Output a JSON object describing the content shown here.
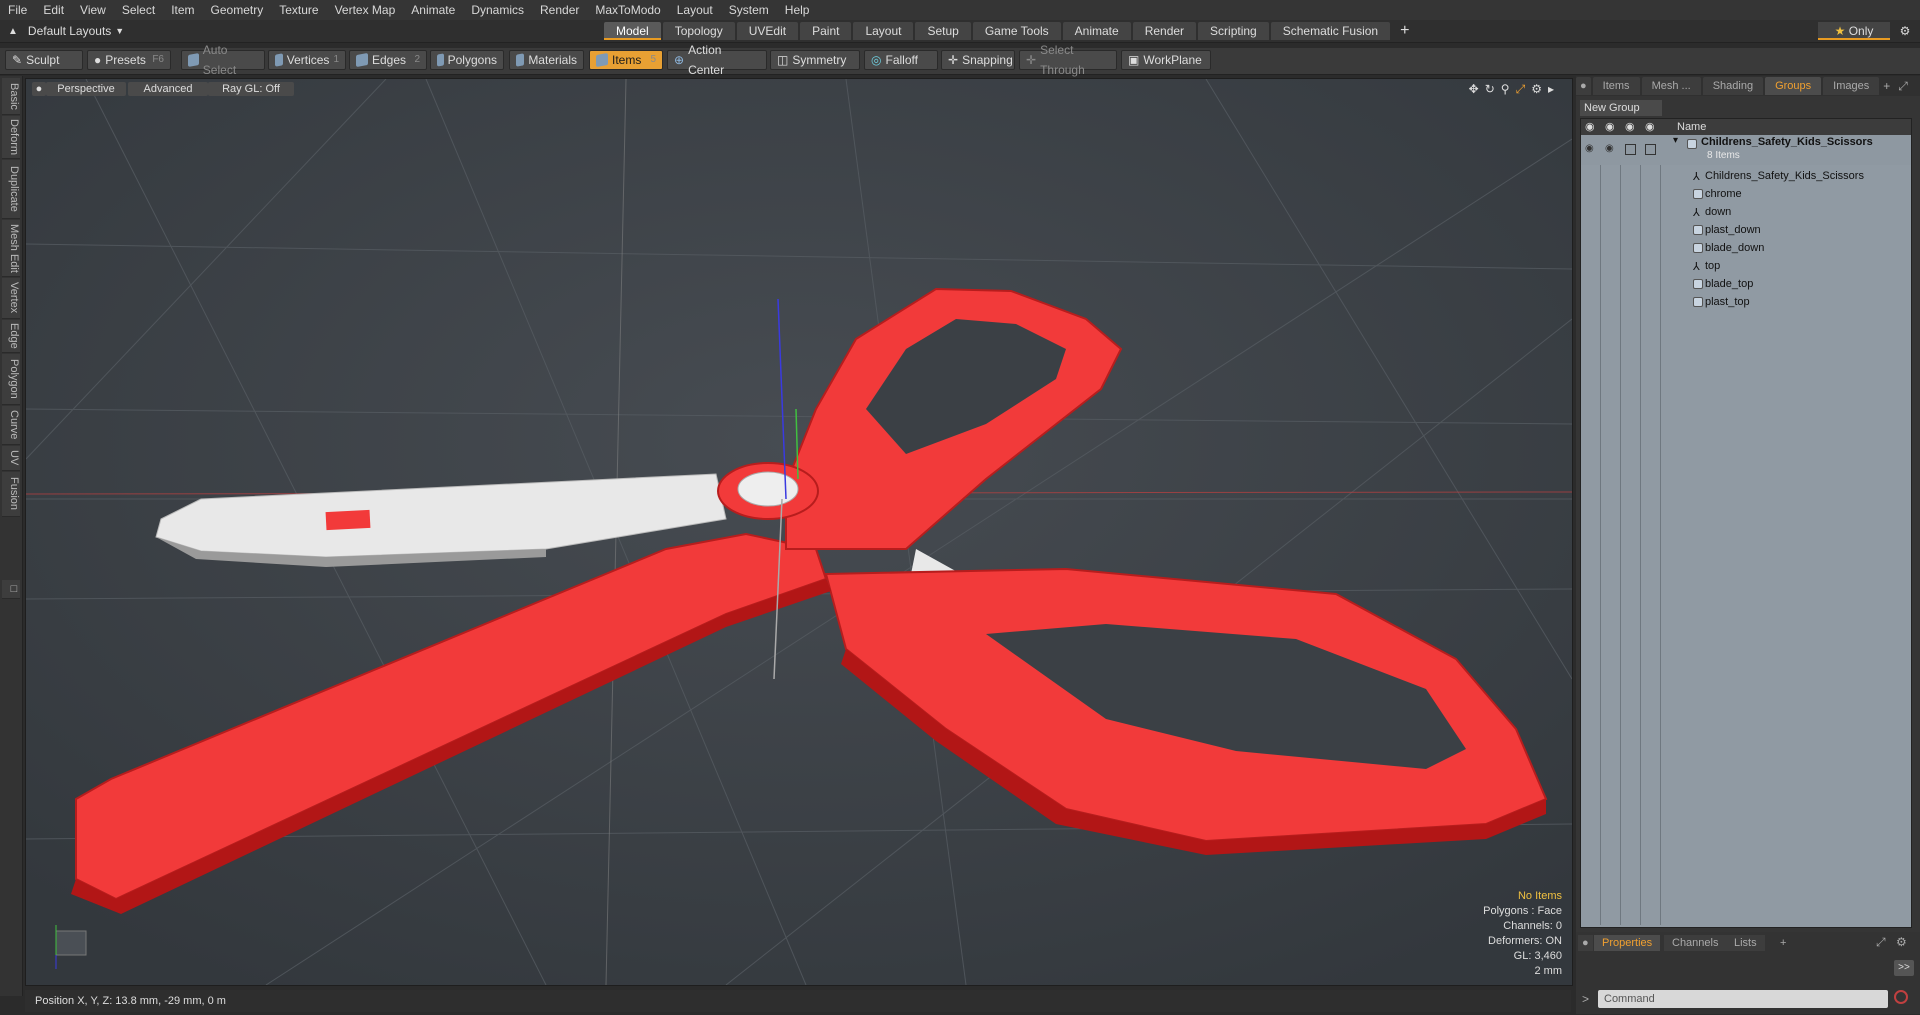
{
  "menu": [
    "File",
    "Edit",
    "View",
    "Select",
    "Item",
    "Geometry",
    "Texture",
    "Vertex Map",
    "Animate",
    "Dynamics",
    "Render",
    "MaxToModo",
    "Layout",
    "System",
    "Help"
  ],
  "layout_selector": "Default Layouts",
  "tabs": [
    "Model",
    "Topology",
    "UVEdit",
    "Paint",
    "Layout",
    "Setup",
    "Game Tools",
    "Animate",
    "Render",
    "Scripting",
    "Schematic Fusion"
  ],
  "active_tab": "Model",
  "only_label": "Only",
  "toolbar": {
    "sculpt": "Sculpt",
    "presets": "Presets",
    "presets_key": "F6",
    "auto_select": "Auto Select",
    "vertices": "Vertices",
    "vertices_key": "1",
    "edges": "Edges",
    "edges_key": "2",
    "polygons": "Polygons",
    "materials": "Materials",
    "items": "Items",
    "items_key": "5",
    "action_center": "Action Center",
    "symmetry": "Symmetry",
    "falloff": "Falloff",
    "snapping": "Snapping",
    "select_through": "Select Through",
    "workplane": "WorkPlane"
  },
  "left_tabs": [
    "Basic",
    "Deform",
    "Duplicate",
    "Mesh Edit",
    "Vertex",
    "Edge",
    "Polygon",
    "Curve",
    "UV",
    "Fusion"
  ],
  "viewport": {
    "view": "Perspective",
    "shading": "Advanced",
    "raygl": "Ray GL: Off",
    "info": {
      "selection": "No Items",
      "polygons": "Polygons : Face",
      "channels": "Channels: 0",
      "deformers": "Deformers: ON",
      "gl": "GL: 3,460",
      "scale": "2 mm"
    }
  },
  "status": "Position X, Y, Z:  13.8 mm, -29 mm, 0 m",
  "right_panel": {
    "tabs": [
      "Items",
      "Mesh ...",
      "Shading",
      "Groups",
      "Images"
    ],
    "active_tab": "Groups",
    "new_group": "New Group",
    "column_name": "Name",
    "group_name": "Childrens_Safety_Kids_Scissors",
    "group_count": "8 Items",
    "items": [
      {
        "name": "Childrens_Safety_Kids_Scissors",
        "type": "locator"
      },
      {
        "name": "chrome",
        "type": "mesh"
      },
      {
        "name": "down",
        "type": "locator"
      },
      {
        "name": "plast_down",
        "type": "mesh"
      },
      {
        "name": "blade_down",
        "type": "mesh"
      },
      {
        "name": "top",
        "type": "locator"
      },
      {
        "name": "blade_top",
        "type": "mesh"
      },
      {
        "name": "plast_top",
        "type": "mesh"
      }
    ],
    "bottom_tabs": [
      "Properties",
      "Channels",
      "Lists"
    ],
    "bottom_active": "Properties",
    "command_placeholder": "Command",
    "expand_label": ">>"
  },
  "colors": {
    "accent": "#e8a033",
    "scissor_red": "#f23a3a",
    "blade_white": "#e8e8e8",
    "viewport_bg": "#3b4045"
  }
}
